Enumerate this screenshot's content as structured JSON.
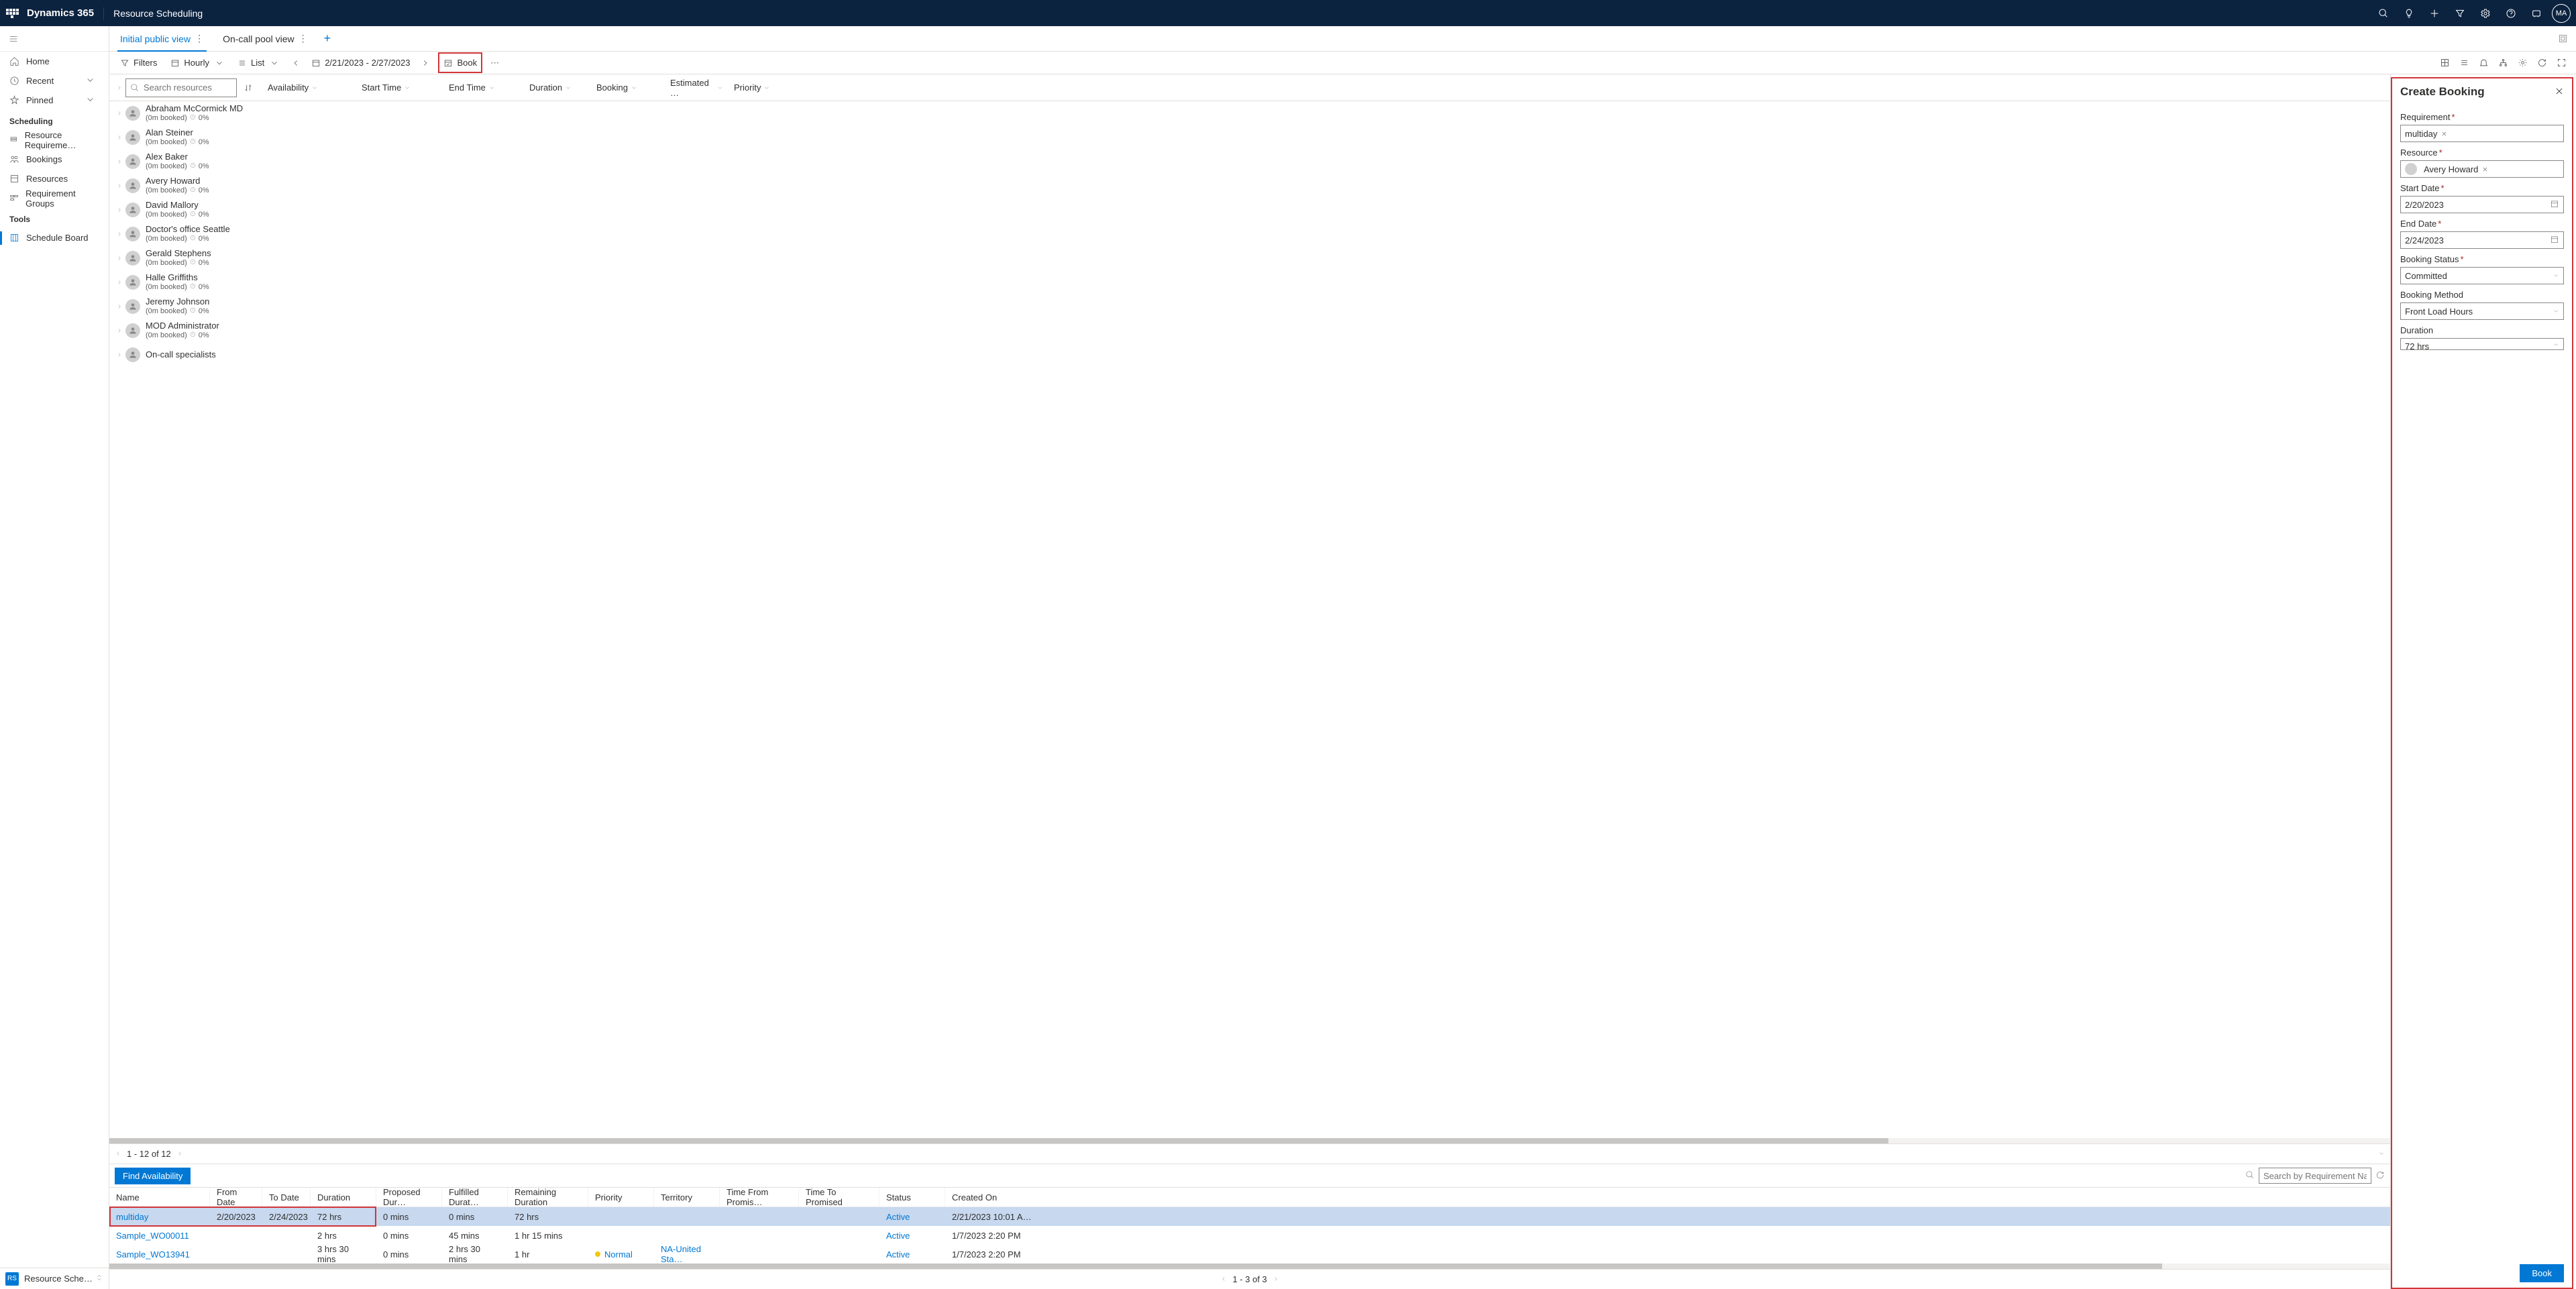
{
  "topbar": {
    "brand": "Dynamics 365",
    "app": "Resource Scheduling",
    "avatar": "MA"
  },
  "sidebar": {
    "home": "Home",
    "recent": "Recent",
    "pinned": "Pinned",
    "section_scheduling": "Scheduling",
    "items": [
      {
        "label": "Resource Requireme…"
      },
      {
        "label": "Bookings"
      },
      {
        "label": "Resources"
      },
      {
        "label": "Requirement Groups"
      }
    ],
    "section_tools": "Tools",
    "schedule_board": "Schedule Board",
    "footer_badge": "RS",
    "footer_label": "Resource Schedul…"
  },
  "tabs": {
    "items": [
      {
        "label": "Initial public view",
        "active": true
      },
      {
        "label": "On-call pool view",
        "active": false
      }
    ]
  },
  "toolbar": {
    "filters": "Filters",
    "hourly": "Hourly",
    "list": "List",
    "date_range": "2/21/2023 - 2/27/2023",
    "book": "Book"
  },
  "board": {
    "search_placeholder": "Search resources",
    "columns": [
      "Availability",
      "Start Time",
      "End Time",
      "Duration",
      "Booking",
      "Estimated …",
      "Priority"
    ],
    "resources": [
      {
        "name": "Abraham McCormick MD",
        "sub": "(0m booked)",
        "pct": "0%"
      },
      {
        "name": "Alan Steiner",
        "sub": "(0m booked)",
        "pct": "0%"
      },
      {
        "name": "Alex Baker",
        "sub": "(0m booked)",
        "pct": "0%"
      },
      {
        "name": "Avery Howard",
        "sub": "(0m booked)",
        "pct": "0%"
      },
      {
        "name": "David Mallory",
        "sub": "(0m booked)",
        "pct": "0%"
      },
      {
        "name": "Doctor's office Seattle",
        "sub": "(0m booked)",
        "pct": "0%"
      },
      {
        "name": "Gerald Stephens",
        "sub": "(0m booked)",
        "pct": "0%"
      },
      {
        "name": "Halle Griffiths",
        "sub": "(0m booked)",
        "pct": "0%"
      },
      {
        "name": "Jeremy Johnson",
        "sub": "(0m booked)",
        "pct": "0%"
      },
      {
        "name": "MOD Administrator",
        "sub": "(0m booked)",
        "pct": "0%"
      },
      {
        "name": "On-call specialists",
        "sub": "",
        "pct": ""
      }
    ],
    "pager": "1 - 12 of 12"
  },
  "panel": {
    "title": "Create Booking",
    "requirement_label": "Requirement",
    "requirement_value": "multiday",
    "resource_label": "Resource",
    "resource_value": "Avery Howard",
    "start_date_label": "Start Date",
    "start_date_value": "2/20/2023",
    "end_date_label": "End Date",
    "end_date_value": "2/24/2023",
    "status_label": "Booking Status",
    "status_value": "Committed",
    "method_label": "Booking Method",
    "method_value": "Front Load Hours",
    "duration_label": "Duration",
    "duration_value": "72 hrs",
    "book_button": "Book"
  },
  "req": {
    "find": "Find Availability",
    "search_placeholder": "Search by Requirement Name",
    "columns": [
      "Name",
      "From Date",
      "To Date",
      "Duration",
      "Proposed Dur…",
      "Fulfilled Durat…",
      "Remaining Duration",
      "Priority",
      "Territory",
      "Time From Promis…",
      "Time To Promised",
      "Status",
      "Created On"
    ],
    "rows": [
      {
        "name": "multiday",
        "from": "2/20/2023",
        "to": "2/24/2023",
        "dur": "72 hrs",
        "pd": "0 mins",
        "fd": "0 mins",
        "rd": "72 hrs",
        "pr": "",
        "ter": "",
        "tfp": "",
        "ttp": "",
        "st": "Active",
        "co": "2/21/2023 10:01 A…",
        "sel": true
      },
      {
        "name": "Sample_WO00011",
        "from": "",
        "to": "",
        "dur": "2 hrs",
        "pd": "0 mins",
        "fd": "45 mins",
        "rd": "1 hr 15 mins",
        "pr": "",
        "ter": "",
        "tfp": "",
        "ttp": "",
        "st": "Active",
        "co": "1/7/2023 2:20 PM"
      },
      {
        "name": "Sample_WO13941",
        "from": "",
        "to": "",
        "dur": "3 hrs 30 mins",
        "pd": "0 mins",
        "fd": "2 hrs 30 mins",
        "rd": "1 hr",
        "pr": "Normal",
        "ter": "NA-United Sta…",
        "tfp": "",
        "ttp": "",
        "st": "Active",
        "co": "1/7/2023 2:20 PM"
      }
    ],
    "pager": "1 - 3 of 3"
  }
}
